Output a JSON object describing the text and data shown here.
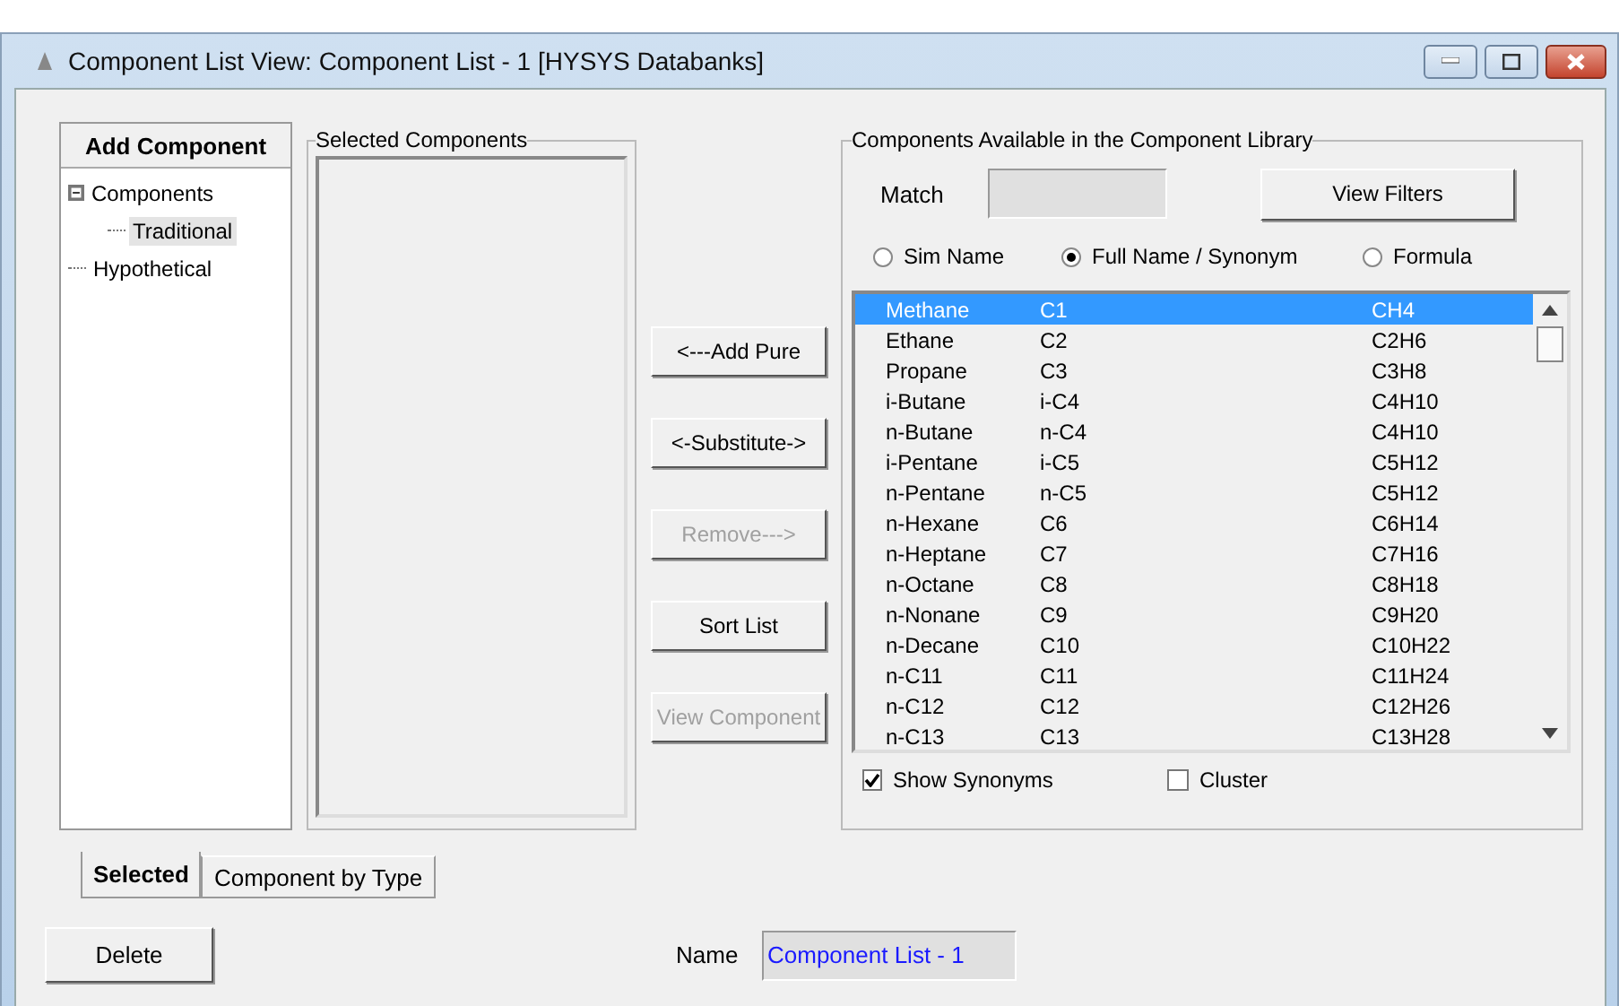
{
  "window": {
    "title": "Component List View: Component List - 1 [HYSYS Databanks]"
  },
  "tree": {
    "heading": "Add Component",
    "items": [
      {
        "label": "Components",
        "expanded": true,
        "selected": false,
        "children": [
          {
            "label": "Traditional",
            "selected": true
          }
        ]
      },
      {
        "label": "Hypothetical",
        "selected": false
      }
    ]
  },
  "selected_components": {
    "title": "Selected Components"
  },
  "actions": [
    {
      "label": "<---Add Pure",
      "disabled": false
    },
    {
      "label": "<-Substitute->",
      "disabled": false
    },
    {
      "label": "Remove--->",
      "disabled": true
    },
    {
      "label": "Sort List",
      "disabled": false
    },
    {
      "label": "View Component",
      "disabled": true
    }
  ],
  "library": {
    "title": "Components Available in the Component Library",
    "match_label": "Match",
    "view_filters": "View Filters",
    "search_by": [
      {
        "label": "Sim Name",
        "selected": false
      },
      {
        "label": "Full Name / Synonym",
        "selected": true
      },
      {
        "label": "Formula",
        "selected": false
      }
    ],
    "rows": [
      {
        "name": "Methane",
        "sim_name": "C1",
        "formula": "CH4",
        "selected": true
      },
      {
        "name": "Ethane",
        "sim_name": "C2",
        "formula": "C2H6",
        "selected": false
      },
      {
        "name": "Propane",
        "sim_name": "C3",
        "formula": "C3H8",
        "selected": false
      },
      {
        "name": "i-Butane",
        "sim_name": "i-C4",
        "formula": "C4H10",
        "selected": false
      },
      {
        "name": "n-Butane",
        "sim_name": "n-C4",
        "formula": "C4H10",
        "selected": false
      },
      {
        "name": "i-Pentane",
        "sim_name": "i-C5",
        "formula": "C5H12",
        "selected": false
      },
      {
        "name": "n-Pentane",
        "sim_name": "n-C5",
        "formula": "C5H12",
        "selected": false
      },
      {
        "name": "n-Hexane",
        "sim_name": "C6",
        "formula": "C6H14",
        "selected": false
      },
      {
        "name": "n-Heptane",
        "sim_name": "C7",
        "formula": "C7H16",
        "selected": false
      },
      {
        "name": "n-Octane",
        "sim_name": "C8",
        "formula": "C8H18",
        "selected": false
      },
      {
        "name": "n-Nonane",
        "sim_name": "C9",
        "formula": "C9H20",
        "selected": false
      },
      {
        "name": "n-Decane",
        "sim_name": "C10",
        "formula": "C10H22",
        "selected": false
      },
      {
        "name": "n-C11",
        "sim_name": "C11",
        "formula": "C11H24",
        "selected": false
      },
      {
        "name": "n-C12",
        "sim_name": "C12",
        "formula": "C12H26",
        "selected": false
      },
      {
        "name": "n-C13",
        "sim_name": "C13",
        "formula": "C13H28",
        "selected": false
      }
    ],
    "options": [
      {
        "label": "Show Synonyms",
        "checked": true
      },
      {
        "label": "Cluster",
        "checked": false
      }
    ]
  },
  "tabs": [
    {
      "label": "Selected",
      "selected": true
    },
    {
      "label": "Component by Type",
      "selected": false
    }
  ],
  "delete_button": "Delete",
  "name_field": {
    "label": "Name",
    "value": "Component List - 1"
  }
}
